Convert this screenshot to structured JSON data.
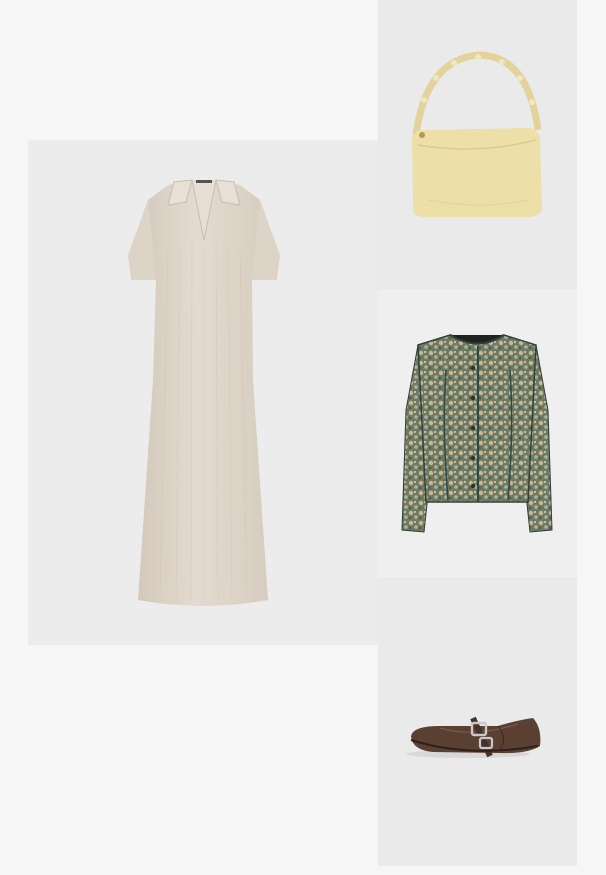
{
  "outfit": {
    "items": [
      {
        "id": "dress",
        "kind": "ribbed-knit-polo-maxi-dress",
        "color": "#ded4c9"
      },
      {
        "id": "bag",
        "kind": "shoulder-bag",
        "color": "#ecdfa8"
      },
      {
        "id": "jacket",
        "kind": "floral-quilted-jacket",
        "color": "#6f7a62"
      },
      {
        "id": "shoes",
        "kind": "buckle-ballet-flats",
        "color": "#5a3f33"
      }
    ]
  },
  "colors": {
    "page_background": "#f6f6f6",
    "panel_background": "#ececec"
  }
}
